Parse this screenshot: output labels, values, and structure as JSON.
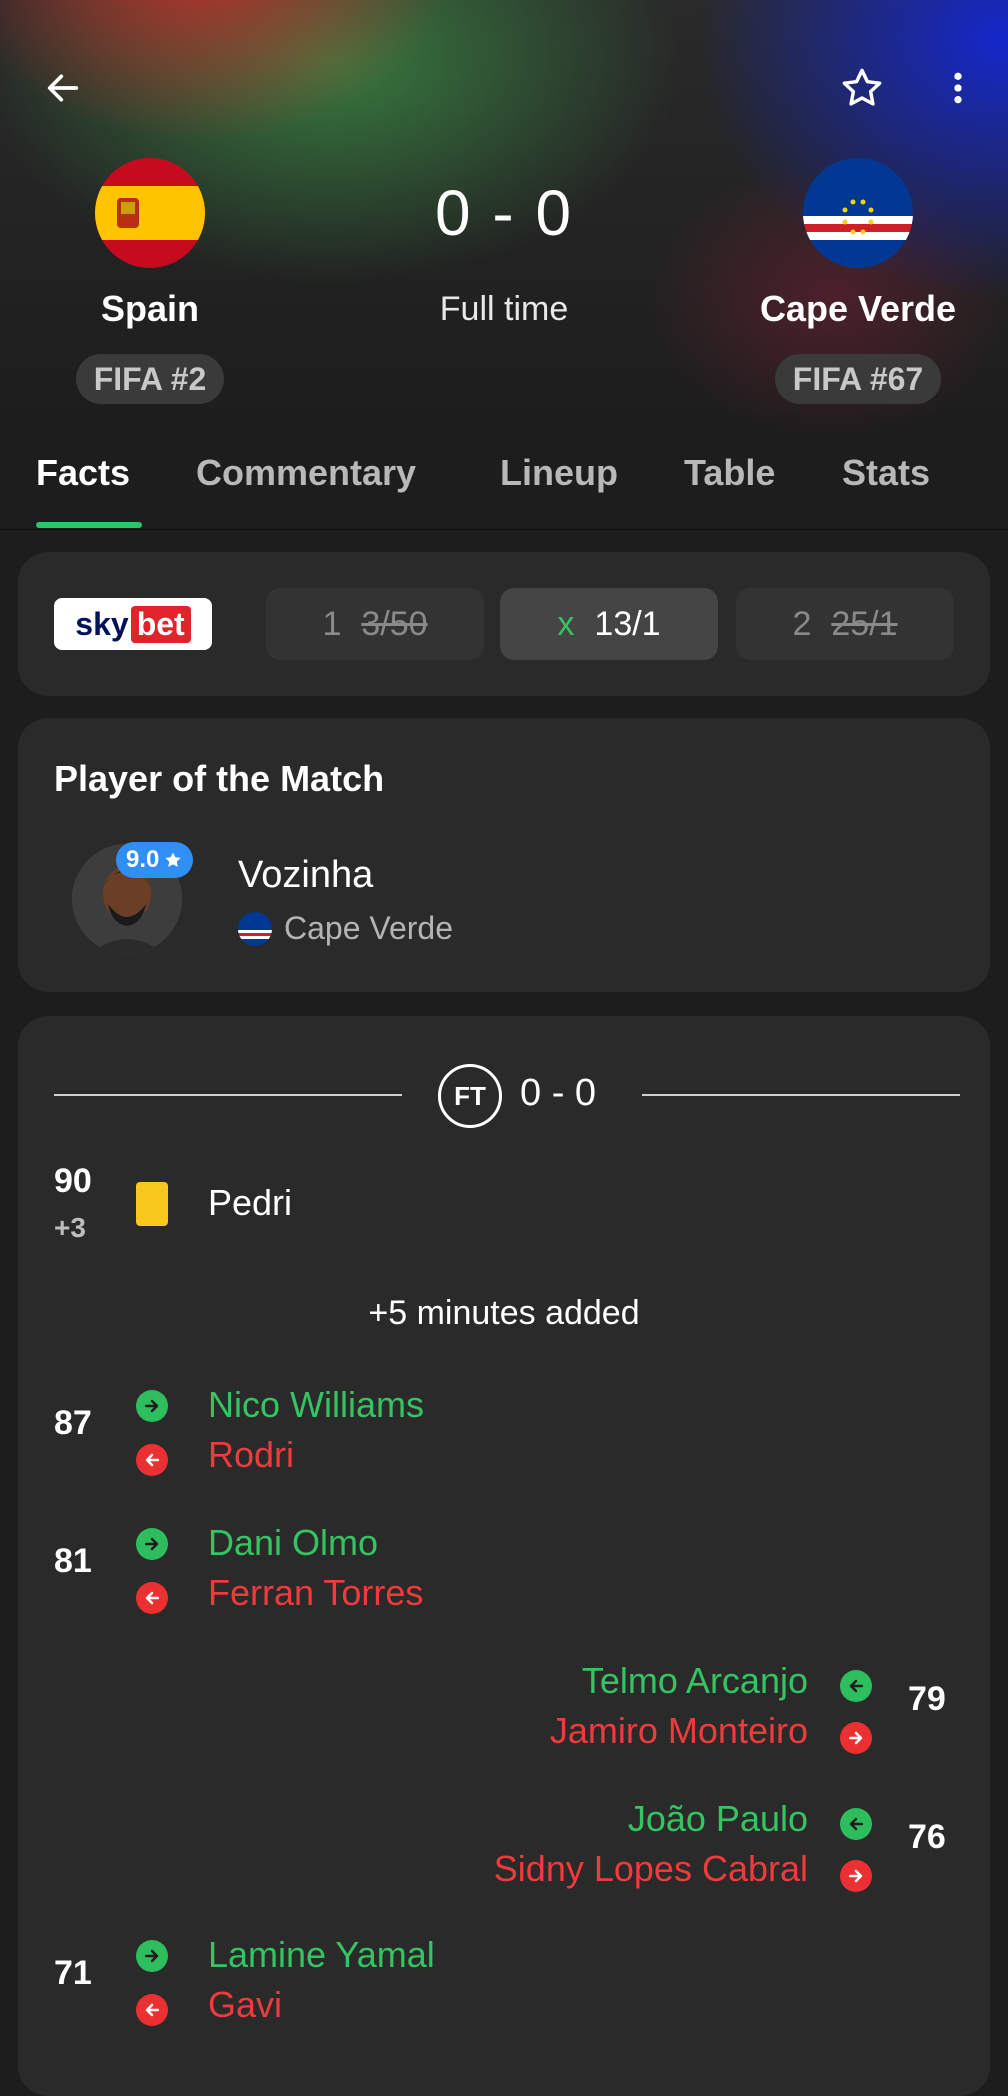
{
  "header": {
    "home": {
      "name": "Spain",
      "rank": "FIFA #2"
    },
    "away": {
      "name": "Cape Verde",
      "rank": "FIFA #67"
    },
    "score": "0 - 0",
    "status": "Full time"
  },
  "tabs": [
    {
      "label": "Facts",
      "active": true
    },
    {
      "label": "Commentary"
    },
    {
      "label": "Lineup"
    },
    {
      "label": "Table"
    },
    {
      "label": "Stats"
    }
  ],
  "odds": {
    "provider": {
      "sky": "sky",
      "bet": "bet"
    },
    "options": [
      {
        "label": "1",
        "value": "3/50",
        "selected": false
      },
      {
        "label": "x",
        "value": "13/1",
        "selected": true
      },
      {
        "label": "2",
        "value": "25/1",
        "selected": false
      }
    ]
  },
  "potm": {
    "title": "Player of the Match",
    "rating": "9.0",
    "player": "Vozinha",
    "team": "Cape Verde"
  },
  "events": {
    "ft_badge": "FT",
    "ft_score": "0 - 0",
    "added_time": "+5 minutes added",
    "card": {
      "minute": "90",
      "extra": "+3",
      "player": "Pedri"
    },
    "subs": [
      {
        "minute": "87",
        "in": "Nico Williams",
        "out": "Rodri",
        "side": "home"
      },
      {
        "minute": "81",
        "in": "Dani Olmo",
        "out": "Ferran Torres",
        "side": "home"
      },
      {
        "minute": "79",
        "in": "Telmo Arcanjo",
        "out": "Jamiro Monteiro",
        "side": "away"
      },
      {
        "minute": "76",
        "in": "João Paulo",
        "out": "Sidny Lopes Cabral",
        "side": "away"
      },
      {
        "minute": "71",
        "in": "Lamine Yamal",
        "out": "Gavi",
        "side": "home"
      }
    ]
  },
  "colors": {
    "accent_green": "#35c462",
    "sub_out_red": "#ef3b3b",
    "yellow_card": "#f9c81e",
    "rating_blue": "#2f8ff5"
  },
  "icons": [
    "back-arrow-icon",
    "star-icon",
    "more-vertical-icon",
    "spain-flag-icon",
    "cape-verde-flag-icon",
    "yellow-card-icon",
    "sub-in-icon",
    "sub-out-icon"
  ]
}
